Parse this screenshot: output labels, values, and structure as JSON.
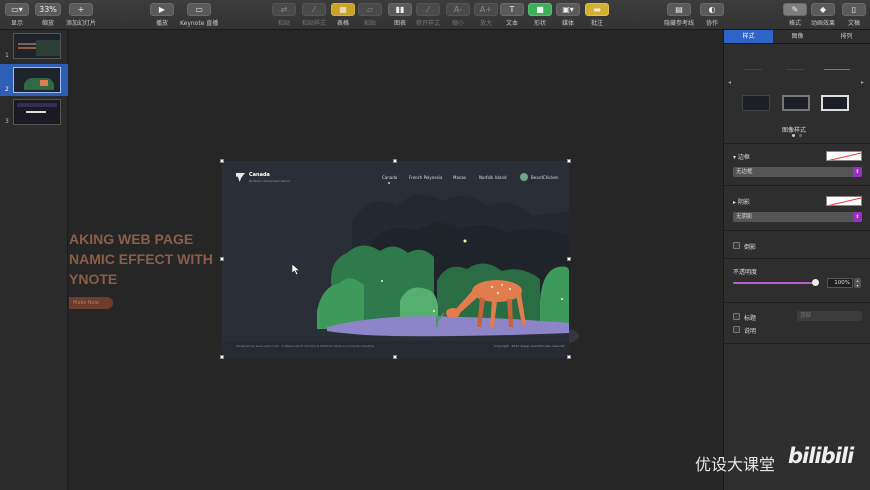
{
  "toolbar": {
    "view_label": "显示",
    "zoom_value": "33%",
    "zoom_label": "缩放",
    "add_slide_label": "添加幻灯片",
    "play_label": "播放",
    "keynote_live_label": "Keynote 直播",
    "group_label": "组合",
    "disperse_label": "粘贴样式",
    "table_label": "表格",
    "chart_label": "图表",
    "text_label": "文本",
    "shape_label": "形状",
    "media_label": "媒体",
    "comment_label": "批注",
    "guides_label": "隐藏参考线",
    "collaborate_label": "协作",
    "format_label": "格式",
    "animate_label": "动画效果",
    "document_label": "文稿",
    "dim_labels": [
      "粘贴",
      "移开样式",
      "缩小",
      "放大"
    ]
  },
  "navigator": {
    "slides": [
      {
        "num": "1",
        "active": false
      },
      {
        "num": "2",
        "active": true
      },
      {
        "num": "3",
        "active": false
      }
    ]
  },
  "canvas": {
    "ghost_lines": [
      "AKING WEB PAGE",
      "NAMIC EFFECT WITH",
      "YNOTE"
    ],
    "ghost_button": "Make Now"
  },
  "slide": {
    "brand": "Canada",
    "tagline": "Northern Wilderness Island",
    "nav": [
      "Canada",
      "French Polynesia",
      "Macao",
      "Norfolk Island"
    ],
    "user": "BeardChicken",
    "footer_left": "Designed by www.uisdc.com  ·  A Response To Chrome & Netbook Show & Computer Desktop",
    "footer_right": "Copyright · 2022 design beardchicken.idea.net"
  },
  "inspector": {
    "tabs": [
      "样式",
      "图像",
      "排列"
    ],
    "image_style_title": "图像样式",
    "border_label": "边框",
    "border_value": "无边框",
    "shadow_label": "阴影",
    "shadow_value": "无阴影",
    "reflection_label": "倒影",
    "opacity_label": "不透明度",
    "opacity_value": "100%",
    "title_label": "标题",
    "title_position": "顶部",
    "caption_label": "说明"
  },
  "watermark": {
    "text": "优设大课堂",
    "logo": "bilibili"
  },
  "colors": {
    "accent": "#2e63c8",
    "popup_accent": "#9a2fc4",
    "deer": "#e07c4e",
    "foliage": "#3e9a5a"
  }
}
